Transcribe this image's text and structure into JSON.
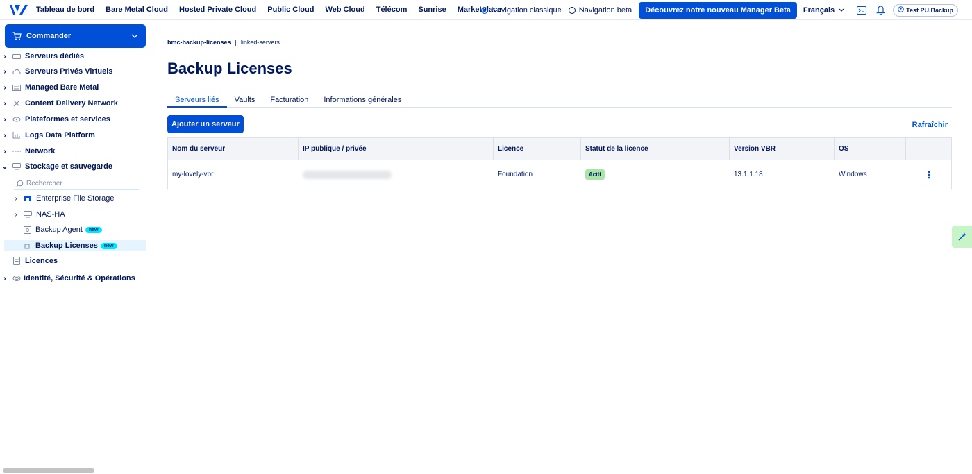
{
  "topbar": {
    "nav": [
      "Tableau de bord",
      "Bare Metal Cloud",
      "Hosted Private Cloud",
      "Public Cloud",
      "Web Cloud",
      "Télécom",
      "Sunrise",
      "Marketplace"
    ],
    "nav_classic": "Navigation classique",
    "nav_beta": "Navigation beta",
    "beta_button": "Découvrez notre nouveau Manager Beta",
    "language": "Français",
    "account": "Test PU.Backup"
  },
  "sidebar": {
    "order_button": "Commander",
    "search_placeholder": "Rechercher",
    "items": {
      "dedicated": "Serveurs dédiés",
      "vps": "Serveurs Privés Virtuels",
      "managed_bare_metal": "Managed Bare Metal",
      "cdn": "Content Delivery Network",
      "platforms": "Plateformes et services",
      "logs": "Logs Data Platform",
      "network": "Network",
      "storage": "Stockage et sauvegarde",
      "efs": "Enterprise File Storage",
      "nas": "NAS-HA",
      "backup_agent": "Backup Agent",
      "backup_licenses": "Backup Licenses",
      "licences": "Licences",
      "identity": "Identité, Sécurité & Opérations"
    },
    "badge_new": "new"
  },
  "main": {
    "breadcrumb": {
      "root": "bmc-backup-licenses",
      "separator": "|",
      "current": "linked-servers"
    },
    "title": "Backup Licenses",
    "tabs": [
      "Serveurs liés",
      "Vaults",
      "Facturation",
      "Informations générales"
    ],
    "add_button": "Ajouter un serveur",
    "refresh": "Rafraîchir",
    "table": {
      "headers": [
        "Nom du serveur",
        "IP publique / privée",
        "Licence",
        "Statut de la licence",
        "Version VBR",
        "OS"
      ],
      "rows": [
        {
          "name": "my-lovely-vbr",
          "licence": "Foundation",
          "status": "Actif",
          "version": "13.1.1.18",
          "os": "Windows"
        }
      ]
    }
  },
  "colors": {
    "brand": "#0050d7",
    "text": "#00185e",
    "new_badge": "#00e5ff",
    "status_active": "#a8e6a8"
  }
}
